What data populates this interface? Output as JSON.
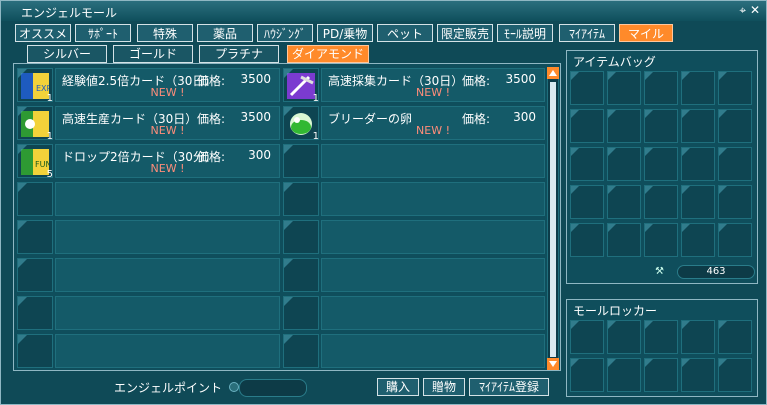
{
  "window": {
    "title": "エンジェルモール",
    "controls": [
      "pin-icon",
      "close-icon"
    ],
    "close_glyph": "✕",
    "pin_glyph": "⌖"
  },
  "tabs": {
    "items": [
      {
        "label": "オススメ",
        "active": false
      },
      {
        "label": "ｻﾎﾟｰﾄ",
        "active": false
      },
      {
        "label": "特殊",
        "active": false
      },
      {
        "label": "薬品",
        "active": false
      },
      {
        "label": "ﾊｳｼﾞﾝｸﾞ",
        "active": false
      },
      {
        "label": "PD/乗物",
        "active": false
      },
      {
        "label": "ペット",
        "active": false
      },
      {
        "label": "限定販売",
        "active": false
      },
      {
        "label": "ﾓｰﾙ説明",
        "active": false
      },
      {
        "label": "ﾏｲｱｲﾃﾑ",
        "active": false
      },
      {
        "label": "マイル",
        "active": true
      }
    ]
  },
  "subtabs": {
    "items": [
      {
        "label": "シルバー",
        "active": false
      },
      {
        "label": "ゴールド",
        "active": false
      },
      {
        "label": "プラチナ",
        "active": false
      },
      {
        "label": "ダイアモンド",
        "active": true
      }
    ]
  },
  "items": {
    "price_label": "価格:",
    "new_label": "NEW !",
    "list": [
      {
        "name": "経験値2.5倍カード（30日）",
        "price": "3500",
        "count": "1",
        "icon": "exp-card-icon",
        "new": true
      },
      {
        "name": "高速採集カード（30日）",
        "price": "3500",
        "count": "1",
        "icon": "pickaxe-card-icon",
        "new": true
      },
      {
        "name": "高速生産カード（30日）",
        "price": "3500",
        "count": "1",
        "icon": "production-card-icon",
        "new": true
      },
      {
        "name": "ブリーダーの卵",
        "price": "300",
        "count": "1",
        "icon": "egg-icon",
        "new": true
      },
      {
        "name": "ドロップ2倍カード（30分）",
        "price": "300",
        "count": "5",
        "icon": "drop-card-icon",
        "new": true
      }
    ]
  },
  "item_bag": {
    "title": "アイテムバッグ",
    "amount": "463",
    "amount_icon": "wrench-icon"
  },
  "mall_locker": {
    "title": "モールロッカー"
  },
  "footer": {
    "point_label": "エンジェルポイント",
    "buttons": [
      "購入",
      "贈物",
      "ﾏｲｱｲﾃﾑ登録"
    ]
  }
}
